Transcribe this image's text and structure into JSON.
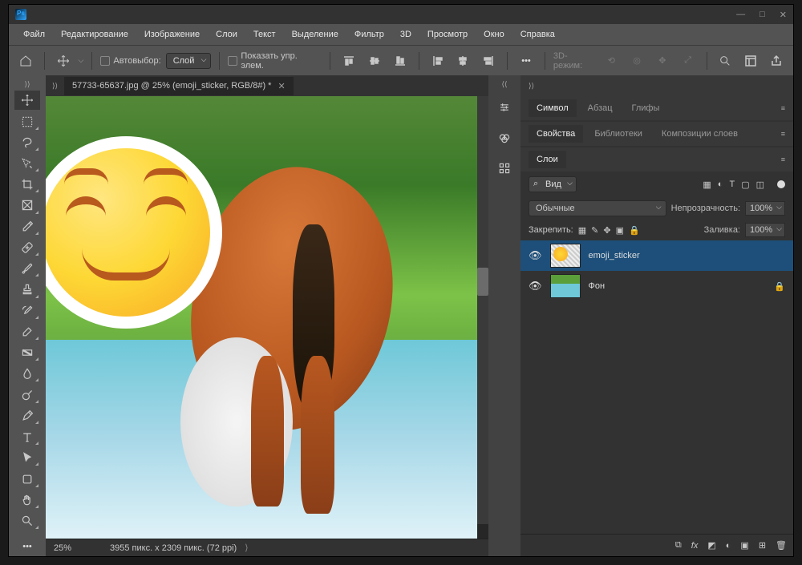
{
  "menubar": [
    "Файл",
    "Редактирование",
    "Изображение",
    "Слои",
    "Текст",
    "Выделение",
    "Фильтр",
    "3D",
    "Просмотр",
    "Окно",
    "Справка"
  ],
  "optbar": {
    "auto_select": "Автовыбор:",
    "target": "Слой",
    "show_controls": "Показать упр. элем.",
    "mode3d": "3D-режим:"
  },
  "doc": {
    "title": "57733-65637.jpg @ 25% (emoji_sticker, RGB/8#) *",
    "zoom": "25%",
    "info": "3955 пикс. x 2309 пикс. (72 ppi)"
  },
  "panels": {
    "top_tabs": [
      "Символ",
      "Абзац",
      "Глифы"
    ],
    "mid_tabs": [
      "Свойства",
      "Библиотеки",
      "Композиции слоев"
    ],
    "layers_tab": "Слои",
    "kind": "Вид",
    "blend": "Обычные",
    "opacity_label": "Непрозрачность:",
    "opacity": "100%",
    "lock_label": "Закрепить:",
    "fill_label": "Заливка:",
    "fill": "100%",
    "layers": [
      {
        "name": "emoji_sticker",
        "locked": false,
        "selected": true
      },
      {
        "name": "Фон",
        "locked": true,
        "selected": false
      }
    ]
  }
}
